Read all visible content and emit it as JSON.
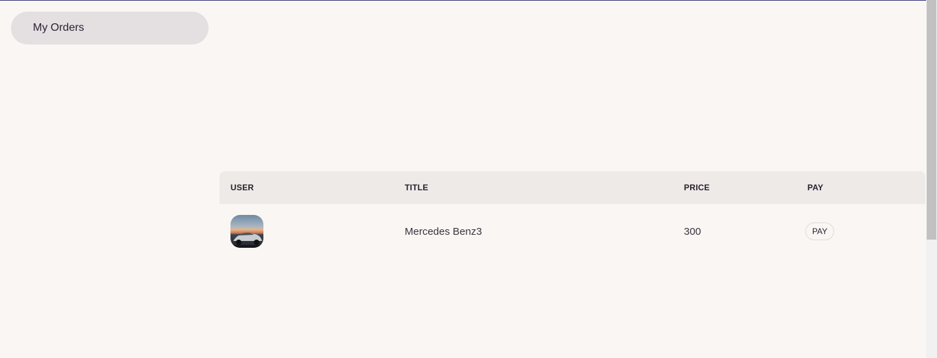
{
  "sidebar": {
    "items": [
      {
        "label": "My Orders"
      }
    ]
  },
  "table": {
    "headers": {
      "user": "USER",
      "title": "TITLE",
      "price": "PRICE",
      "pay": "PAY"
    },
    "rows": [
      {
        "avatar_icon": "car-photo",
        "title": "Mercedes Benz3",
        "price": "300",
        "pay_label": "PAY"
      }
    ]
  },
  "colors": {
    "background": "#faf6f3",
    "sidebar_item_bg": "#e4e0e1",
    "table_header_bg": "#eeeae7",
    "top_border": "#3b3a7a"
  }
}
